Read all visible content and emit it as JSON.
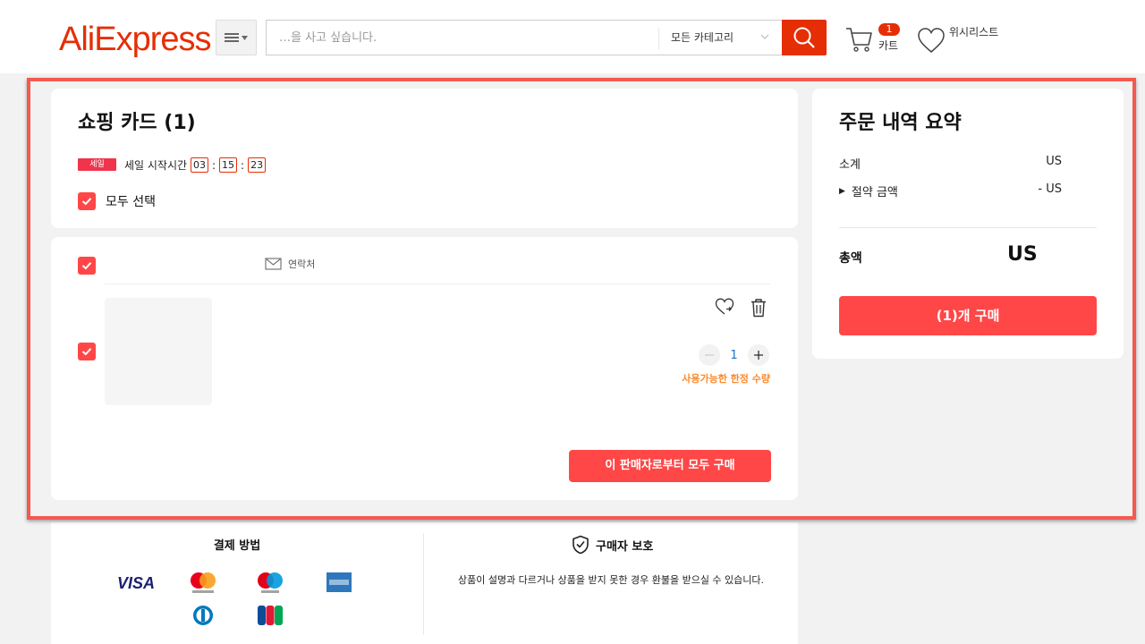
{
  "header": {
    "logo": "AliExpress",
    "search_placeholder": "…을 사고 싶습니다.",
    "category": "모든 카테고리",
    "cart_count": "1",
    "cart_label": "카트",
    "wishlist_label": "위시리스트"
  },
  "cart": {
    "title": "쇼핑 카드 (1)",
    "sale_badge": "세일",
    "sale_text": "세일 시작시간",
    "timer": {
      "h": "03",
      "m": "15",
      "s": "23"
    },
    "select_all": "모두 선택"
  },
  "store": {
    "contact": "연락처",
    "quantity": "1",
    "limited_text": "사용가능한 한정 수량",
    "buy_all": "이 판매자로부터 모두 구매"
  },
  "summary": {
    "title": "주문 내역 요약",
    "subtotal_label": "소계",
    "subtotal_value": "US",
    "savings_label": "절약 금액",
    "savings_value": "- US",
    "total_label": "총액",
    "total_value": "US",
    "checkout": "(1)개 구매"
  },
  "footer": {
    "payment_title": "결제 방법",
    "payment_logos": [
      "visa",
      "mastercard",
      "maestro",
      "american-express",
      "diners-club",
      "jcb"
    ],
    "visa_text": "VISA",
    "protection_title": "구매자 보호",
    "protection_text": "상품이 설명과 다르거나 상품을 받지 못한 경우 환불을 받으실 수 있습니다."
  },
  "colors": {
    "brand": "#e62e04",
    "accent": "#ff4747",
    "highlight": "#f25a4f",
    "limited": "#fd8a2e",
    "quantity": "#1a73c8"
  }
}
